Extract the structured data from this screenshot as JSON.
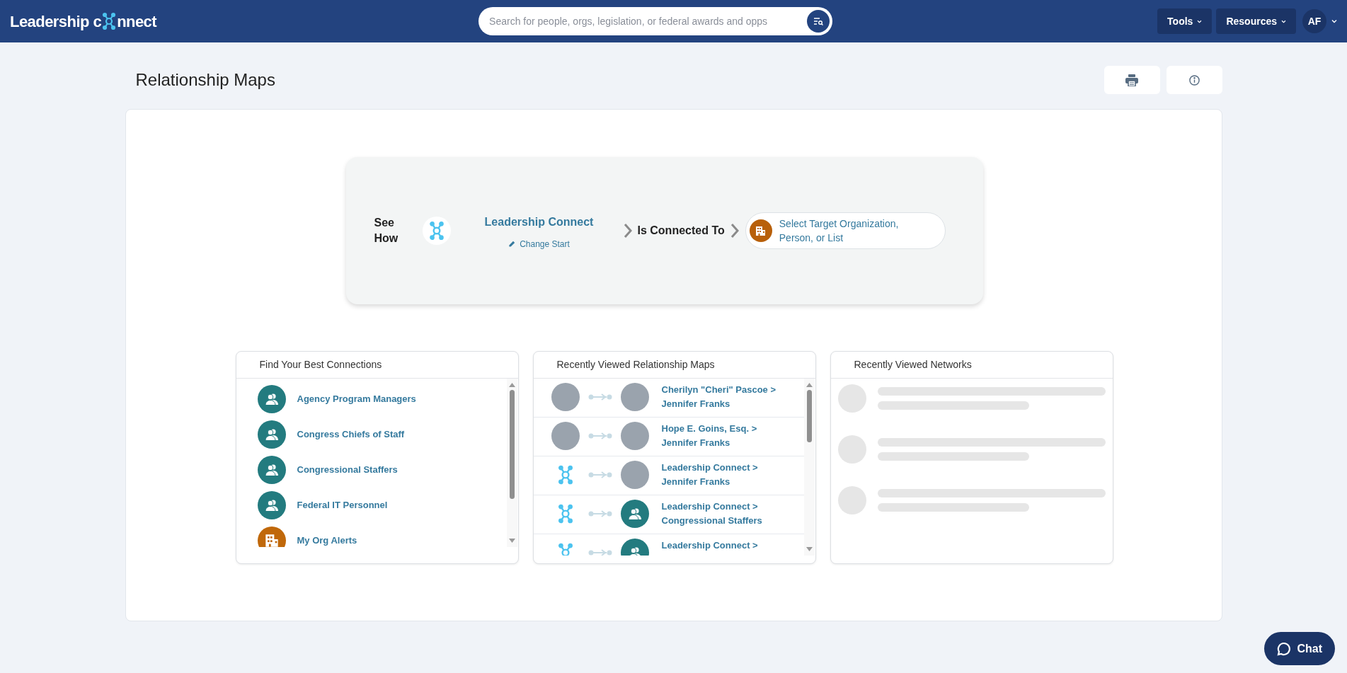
{
  "header": {
    "logo": {
      "before": "Leadership c",
      "after": "nnect"
    },
    "search": {
      "placeholder": "Search for people, orgs, legislation, or federal awards and opps"
    },
    "menus": [
      {
        "label": "Tools"
      },
      {
        "label": "Resources"
      }
    ],
    "user": {
      "initials": "AF"
    }
  },
  "page": {
    "title": "Relationship Maps"
  },
  "builder": {
    "lead": "See How",
    "start": {
      "name": "Leadership Connect",
      "change": "Change Start"
    },
    "relation": "Is Connected To",
    "target": {
      "placeholder": "Select Target Organization, Person, or List"
    }
  },
  "panels": {
    "best_connections": {
      "title": "Find Your Best Connections",
      "items": [
        {
          "kind": "group",
          "label": "Agency Program Managers"
        },
        {
          "kind": "group",
          "label": "Congress Chiefs of Staff"
        },
        {
          "kind": "group",
          "label": "Congressional Staffers"
        },
        {
          "kind": "group",
          "label": "Federal IT Personnel"
        },
        {
          "kind": "org",
          "label": "My Org Alerts"
        }
      ]
    },
    "recent_maps": {
      "title": "Recently Viewed Relationship Maps",
      "items": [
        {
          "source": {
            "kind": "photo"
          },
          "target": {
            "kind": "photo"
          },
          "lines": [
            "Cherilyn \"Cheri\" Pascoe >",
            "Jennifer Franks"
          ]
        },
        {
          "source": {
            "kind": "photo"
          },
          "target": {
            "kind": "photo"
          },
          "lines": [
            "Hope E. Goins, Esq. >",
            "Jennifer Franks"
          ]
        },
        {
          "source": {
            "kind": "logo"
          },
          "target": {
            "kind": "photo"
          },
          "lines": [
            "Leadership Connect >",
            "Jennifer Franks"
          ]
        },
        {
          "source": {
            "kind": "logo"
          },
          "target": {
            "kind": "group"
          },
          "lines": [
            "Leadership Connect >",
            "Congressional Staffers"
          ]
        },
        {
          "source": {
            "kind": "logo"
          },
          "target": {
            "kind": "group"
          },
          "lines": [
            "Leadership Connect >"
          ]
        }
      ]
    },
    "recent_networks": {
      "title": "Recently Viewed Networks"
    }
  },
  "chat": {
    "label": "Chat"
  }
}
